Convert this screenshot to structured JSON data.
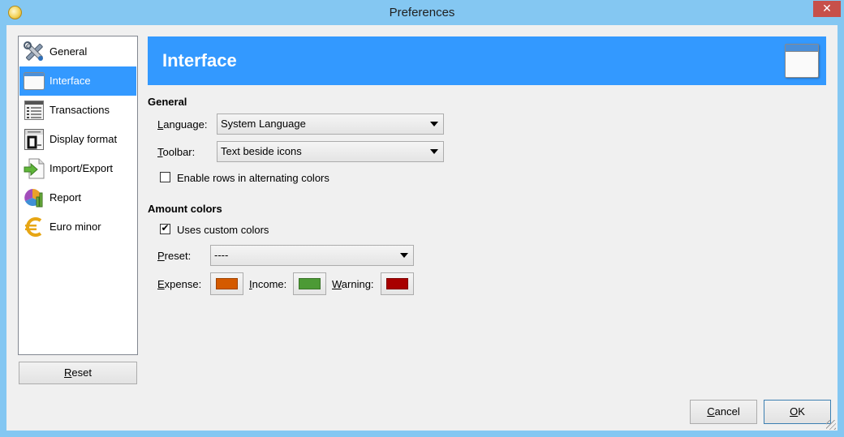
{
  "window": {
    "title": "Preferences",
    "close_glyph": "✕"
  },
  "sidebar": {
    "items": [
      {
        "label": "General",
        "icon": "tools-icon",
        "selected": false
      },
      {
        "label": "Interface",
        "icon": "window-icon",
        "selected": true
      },
      {
        "label": "Transactions",
        "icon": "list-icon",
        "selected": false
      },
      {
        "label": "Display format",
        "icon": "calendar-icon",
        "selected": false
      },
      {
        "label": "Import/Export",
        "icon": "import-export-icon",
        "selected": false
      },
      {
        "label": "Report",
        "icon": "chart-icon",
        "selected": false
      },
      {
        "label": "Euro minor",
        "icon": "euro-icon",
        "selected": false
      }
    ],
    "reset_label": "Reset",
    "reset_mnemonic": "R"
  },
  "header": {
    "title": "Interface",
    "icon": "window-icon"
  },
  "general": {
    "title": "General",
    "language_label": "Language:",
    "language_mnemonic": "L",
    "language_value": "System Language",
    "toolbar_label": "Toolbar:",
    "toolbar_mnemonic": "T",
    "toolbar_value": "Text beside icons",
    "alternating_label": "Enable rows in alternating colors",
    "alternating_checked": false
  },
  "amount_colors": {
    "title": "Amount colors",
    "custom_label": "Uses custom colors",
    "custom_checked": true,
    "preset_label": "Preset:",
    "preset_mnemonic": "P",
    "preset_value": "----",
    "expense_label": "Expense:",
    "expense_mnemonic": "E",
    "expense_color": "#d45a00",
    "income_label": "Income:",
    "income_mnemonic": "I",
    "income_color": "#4c9a35",
    "warning_label": "Warning:",
    "warning_mnemonic": "W",
    "warning_color": "#a80000"
  },
  "buttons": {
    "cancel": "Cancel",
    "cancel_mnemonic": "C",
    "ok": "OK",
    "ok_mnemonic": "O"
  },
  "colors": {
    "accent": "#3399ff",
    "window_border": "#84c7f2",
    "close": "#c7504a"
  }
}
